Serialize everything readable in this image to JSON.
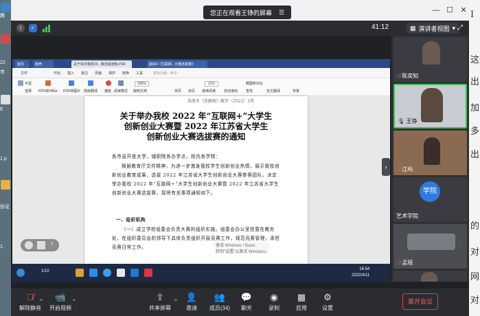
{
  "desktop_left": {
    "labels": [
      "腾",
      "22",
      "市",
      "E",
      "1.p",
      "份证",
      "1."
    ]
  },
  "desktop_right": {
    "glyphs": [
      "I",
      "这",
      "出",
      "加",
      "多",
      "出",
      "的",
      "对",
      "网",
      "对"
    ]
  },
  "titlebar": {
    "banner_text": "您正在观看王铮的屏幕",
    "banner_menu": "☰"
  },
  "infobar": {
    "timer": "41:12",
    "view_mode": "演讲者视图"
  },
  "browser": {
    "tabs": [
      "首页",
      "稻壳",
      "关于举办我校20...赛选拔通知.PDF",
      "副本4《互联网...大赛选拔赛》"
    ]
  },
  "pdf_menu": [
    "文件",
    "开始",
    "插入",
    "批注",
    "页面",
    "保护",
    "转换",
    "工具",
    "查找功能、命令"
  ],
  "pdf_ribbon": {
    "items": [
      "手型",
      "选择",
      "PDF转Office",
      "PDF转图片",
      "高级翻译",
      "播放",
      "阅读模式",
      "旋转文档",
      "单页",
      "双页",
      "连续阅读",
      "自动滚动",
      "截图和对比",
      "查找",
      "全文翻译",
      "背景"
    ],
    "zoom": "100%",
    "page": "1/10"
  },
  "document": {
    "header_fragment": "苏府大（亦政权）政字（2022）2号",
    "title_lines": [
      "关于举办我校 2022 年“互联网+”大学生",
      "创新创业大赛暨 2022 年江苏省大学生",
      "创新创业大赛选拔赛的通知"
    ],
    "salutation": "各市县开放大学，城职院各办学点，校内各学院：",
    "body": "根据教育厅文件精神，为进一步激发我校学生创新创业热情，展示我校创新创业教育成果，选拔 2022 年江苏省大学生创新创业大赛参赛团队，决定举办我校 2022 年“互联网+”大学生创新创业大赛暨 2022 年江苏省大学生创新创业大赛选拔赛，现将有关事项通知如下。",
    "section": "一、组织机构",
    "section_body": "（一）成立学校组委会负责大赛的组织实施。组委会办公室挂靠在教务处，在组织委员会的领导下具体负责组织开展竞赛工作，规范竞赛管理，承担竞赛日常工作。",
    "activation_line1": "激活 Windows / Basic",
    "activation_line2": "转到\"设置\"以激活 Windows。"
  },
  "taskbar": {
    "time": "16:54",
    "date": "2022/4/11",
    "page_counter": "1/10"
  },
  "participants": [
    {
      "name": "陈奕知",
      "mic": "muted"
    },
    {
      "name": "王铮",
      "mic": "on"
    },
    {
      "name": "江屿",
      "mic": "muted"
    },
    {
      "name": "艺术学院",
      "avatar_text": "学院",
      "mic": "none"
    },
    {
      "name": "孟瑶",
      "mic": "muted"
    },
    {
      "name": "",
      "mic": "none"
    }
  ],
  "toolbar": {
    "mute_label": "解除静音",
    "video_label": "开启视频",
    "share_label": "共享屏幕",
    "invite_label": "邀请",
    "members_label": "成员(34)",
    "chat_label": "聊天",
    "record_label": "录制",
    "apps_label": "应用",
    "settings_label": "设置",
    "leave_label": "离开会议"
  },
  "colors": {
    "accent_blue": "#2b4a8b",
    "leave_red": "#ff5c5c",
    "speaker_green": "#3ec25b"
  }
}
